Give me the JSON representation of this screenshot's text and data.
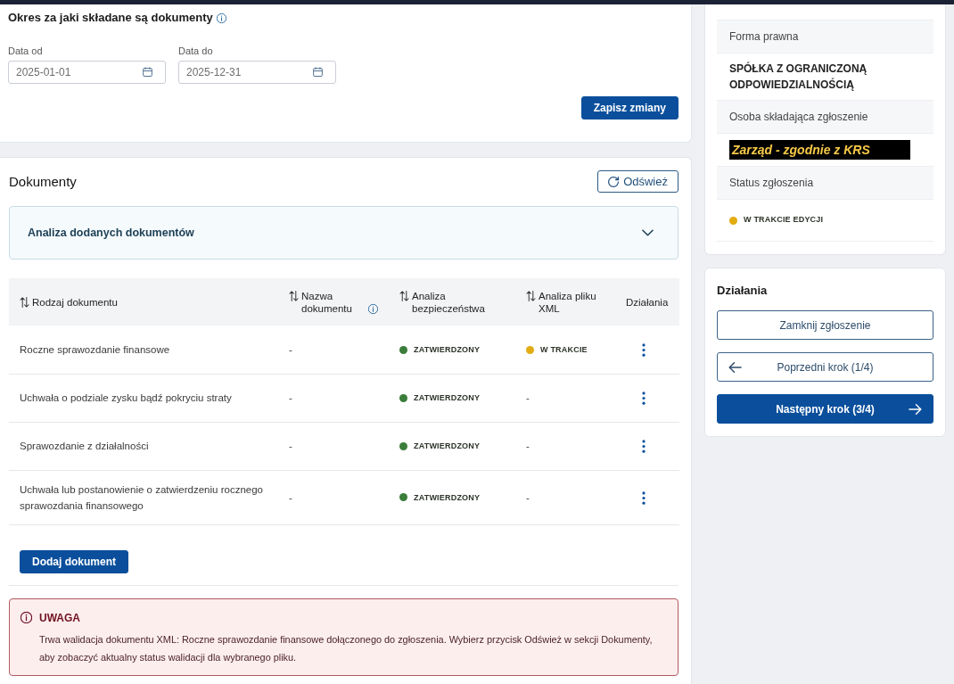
{
  "period": {
    "title": "Okres za jaki składane są dokumenty",
    "info": true,
    "fields": [
      {
        "label": "Data od",
        "value": "2025-01-01"
      },
      {
        "label": "Data do",
        "value": "2025-12-31"
      }
    ],
    "save_button": "Zapisz zmiany"
  },
  "documents": {
    "title": "Dokumenty",
    "refresh_button": "Odśwież",
    "accordion": {
      "title": "Analiza dodanych dokumentów",
      "expanded": false
    },
    "table": {
      "columns": [
        {
          "label": "Rodzaj dokumentu",
          "sortable": true,
          "info": false
        },
        {
          "label": "Nazwa dokumentu",
          "sortable": true,
          "info": true
        },
        {
          "label": "Analiza bezpieczeństwa",
          "sortable": true,
          "info": false
        },
        {
          "label": "Analiza pliku XML",
          "sortable": true,
          "info": false
        },
        {
          "label": "Działania",
          "sortable": false,
          "info": false
        }
      ],
      "rows": [
        {
          "type": "Roczne sprawozdanie finansowe",
          "name": "-",
          "security": {
            "kind": "status",
            "text": "ZATWIERDZONY",
            "color": "#3b7d3b"
          },
          "xml": {
            "kind": "status",
            "text": "W TRAKCIE",
            "color": "#e2ac12"
          }
        },
        {
          "type": "Uchwała o podziale zysku bądź pokryciu straty",
          "name": "-",
          "security": {
            "kind": "status",
            "text": "ZATWIERDZONY",
            "color": "#3b7d3b"
          },
          "xml": {
            "kind": "plain",
            "text": "-"
          }
        },
        {
          "type": "Sprawozdanie z działalności",
          "name": "-",
          "security": {
            "kind": "status",
            "text": "ZATWIERDZONY",
            "color": "#3b7d3b"
          },
          "xml": {
            "kind": "plain",
            "text": "-"
          }
        },
        {
          "type": "Uchwała lub postanowienie o zatwierdzeniu rocznego sprawozdania finansowego",
          "name": "-",
          "security": {
            "kind": "status",
            "text": "ZATWIERDZONY",
            "color": "#3b7d3b"
          },
          "xml": {
            "kind": "plain",
            "text": "-"
          }
        }
      ]
    },
    "add_button": "Dodaj dokument",
    "alert": {
      "title": "UWAGA",
      "message": "Trwa walidacja dokumentu XML: Roczne sprawozdanie finansowe dołączonego do zgłoszenia. Wybierz przycisk Odśwież w sekcji Dokumenty, aby zobaczyć aktualny status walidacji dla wybranego pliku."
    }
  },
  "summary": {
    "rows": [
      {
        "label": "Forma prawna",
        "kind": "text",
        "value": "SPÓŁKA Z OGRANICZONĄ ODPOWIEDZIALNOŚCIĄ"
      },
      {
        "label": "Osoba składająca zgłoszenie",
        "kind": "highlight",
        "value": "Zarząd - zgodnie z KRS"
      },
      {
        "label": "Status zgłoszenia",
        "kind": "status",
        "value": "W TRAKCIE EDYCJI",
        "color": "#e2ac12"
      }
    ]
  },
  "actions": {
    "title": "Działania",
    "buttons": [
      {
        "label": "Zamknij zgłoszenie",
        "kind": "outline"
      },
      {
        "label": "Poprzedni krok (1/4)",
        "kind": "back"
      },
      {
        "label": "Następny krok (3/4)",
        "kind": "next"
      }
    ]
  }
}
